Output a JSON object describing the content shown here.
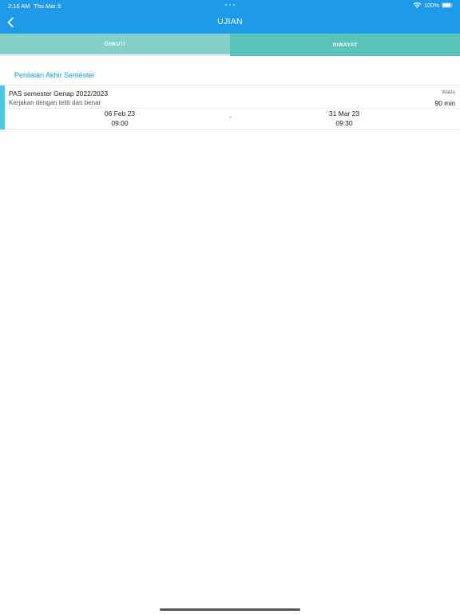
{
  "status_bar": {
    "time": "2:16 AM",
    "date": "Thu Mar 9",
    "battery": "100%"
  },
  "header": {
    "title": "UJIAN",
    "back_icon": "chevron-left-icon",
    "background": "#1d9be8"
  },
  "tabs": [
    {
      "label": "DIIKUTI",
      "active": true
    },
    {
      "label": "RIWAYAT",
      "active": false
    }
  ],
  "section": {
    "title": "Penilaian Akhir Semester"
  },
  "exams": [
    {
      "name": "PAS semester Genap 2022/2023",
      "description": "Kerjakan dengan teliti dan benar",
      "duration_label": "Waktu",
      "duration": "90 min",
      "start_date": "06 Feb 23",
      "start_time": "09:00",
      "separator": "-",
      "end_date": "31 Mar 23",
      "end_time": "09:30"
    }
  ],
  "colors": {
    "accent": "#17a2c7",
    "tab_active": "#84d0c8",
    "tab_inactive": "#5bc4ba",
    "card_accent": "#46c8e0"
  }
}
